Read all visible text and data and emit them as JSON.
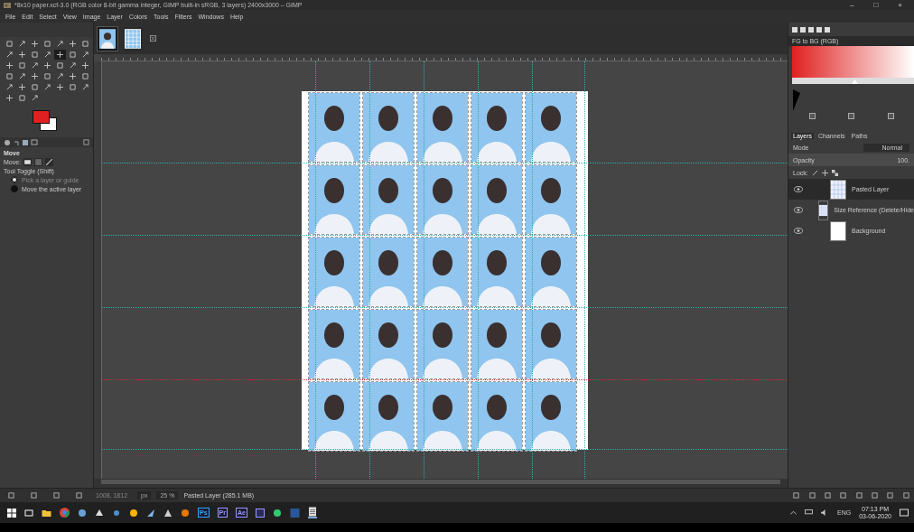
{
  "window": {
    "title": "*8x10 paper.xcf-3.0 (RGB color 8-bit gamma integer, GIMP built-in sRGB, 3 layers) 2400x3000 – GIMP",
    "controls": [
      "–",
      "□",
      "×"
    ]
  },
  "menu": [
    {
      "label": "File"
    },
    {
      "label": "Edit"
    },
    {
      "label": "Select"
    },
    {
      "label": "View"
    },
    {
      "label": "Image"
    },
    {
      "label": "Layer"
    },
    {
      "label": "Colors"
    },
    {
      "label": "Tools"
    },
    {
      "label": "Filters"
    },
    {
      "label": "Windows"
    },
    {
      "label": "Help"
    }
  ],
  "toolbox": {
    "tools": [
      {
        "selected": false
      },
      {
        "selected": false
      },
      {
        "selected": false
      },
      {
        "selected": false
      },
      {
        "selected": false
      },
      {
        "selected": false
      },
      {
        "selected": false
      },
      {
        "selected": false
      },
      {
        "selected": false
      },
      {
        "selected": false
      },
      {
        "selected": false
      },
      {
        "selected": true
      },
      {
        "selected": false
      },
      {
        "selected": false
      },
      {
        "selected": false
      },
      {
        "selected": false
      },
      {
        "selected": false
      },
      {
        "selected": false
      },
      {
        "selected": false
      },
      {
        "selected": false
      },
      {
        "selected": false
      },
      {
        "selected": false
      },
      {
        "selected": false
      },
      {
        "selected": false
      },
      {
        "selected": false
      },
      {
        "selected": false
      },
      {
        "selected": false
      },
      {
        "selected": false
      },
      {
        "selected": false
      },
      {
        "selected": false
      },
      {
        "selected": false
      },
      {
        "selected": false
      },
      {
        "selected": false
      },
      {
        "selected": false
      },
      {
        "selected": false
      },
      {
        "selected": false
      },
      {
        "selected": false
      },
      {
        "selected": false
      }
    ],
    "options": {
      "title": "Move",
      "move_label": "Move:",
      "toggle_label": "Tool Toggle  (Shift)",
      "choices": [
        {
          "label": "Pick a layer or guide",
          "selected": true
        },
        {
          "label": "Move the active layer",
          "selected": false
        }
      ]
    }
  },
  "image_tabs": [
    {
      "kind": "portrait",
      "selected": true
    },
    {
      "kind": "sheet",
      "selected": false
    }
  ],
  "gradient": {
    "name": "FG to BG (RGB)"
  },
  "layers_panel": {
    "tabs": [
      {
        "label": "Layers",
        "selected": true
      },
      {
        "label": "Channels",
        "selected": false
      },
      {
        "label": "Paths",
        "selected": false
      }
    ],
    "mode_label": "Mode",
    "mode_value": "Normal",
    "opacity_label": "Opacity",
    "opacity_value": "100.",
    "lock_label": "Lock:",
    "layers": [
      {
        "name": "Pasted Layer",
        "visible": true,
        "selected": true,
        "kind": "grid"
      },
      {
        "name": "Size Reference (Delete/Hide",
        "visible": true,
        "selected": false,
        "kind": "grid"
      },
      {
        "name": "Background",
        "visible": true,
        "selected": false,
        "kind": "plain"
      }
    ]
  },
  "status": {
    "coords": "1008, 1812",
    "unit": "px",
    "zoom": "25 %",
    "message": "Pasted Layer (285.1 MB)"
  },
  "taskbar": {
    "badges": [
      {
        "label": "Ps",
        "color": "#31a8ff"
      },
      {
        "label": "Pr",
        "color": "#9999ff"
      },
      {
        "label": "Ae",
        "color": "#9999ff"
      }
    ],
    "language": "ENG",
    "time": "07:13 PM",
    "date": "03-06-2020"
  }
}
